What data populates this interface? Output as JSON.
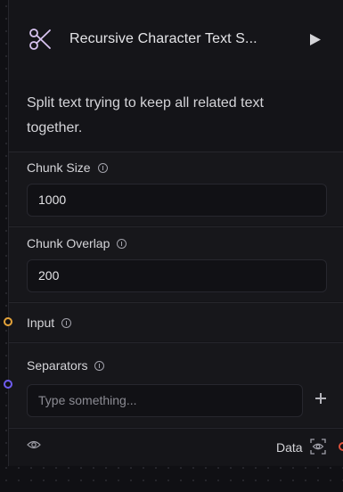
{
  "node": {
    "title": "Recursive Character Text S...",
    "description": "Split text trying to keep all related text together.",
    "icon": "scissors-icon"
  },
  "fields": {
    "chunk_size": {
      "label": "Chunk Size",
      "value": "1000"
    },
    "chunk_overlap": {
      "label": "Chunk Overlap",
      "value": "200"
    },
    "input": {
      "label": "Input"
    },
    "separators": {
      "label": "Separators",
      "placeholder": "Type something..."
    }
  },
  "footer": {
    "output_label": "Data"
  },
  "colors": {
    "input_handle": "#e4a33a",
    "separators_handle": "#6f5cf0",
    "output_handle": "#e0523c",
    "accent_icon": "#d8c3f0"
  }
}
